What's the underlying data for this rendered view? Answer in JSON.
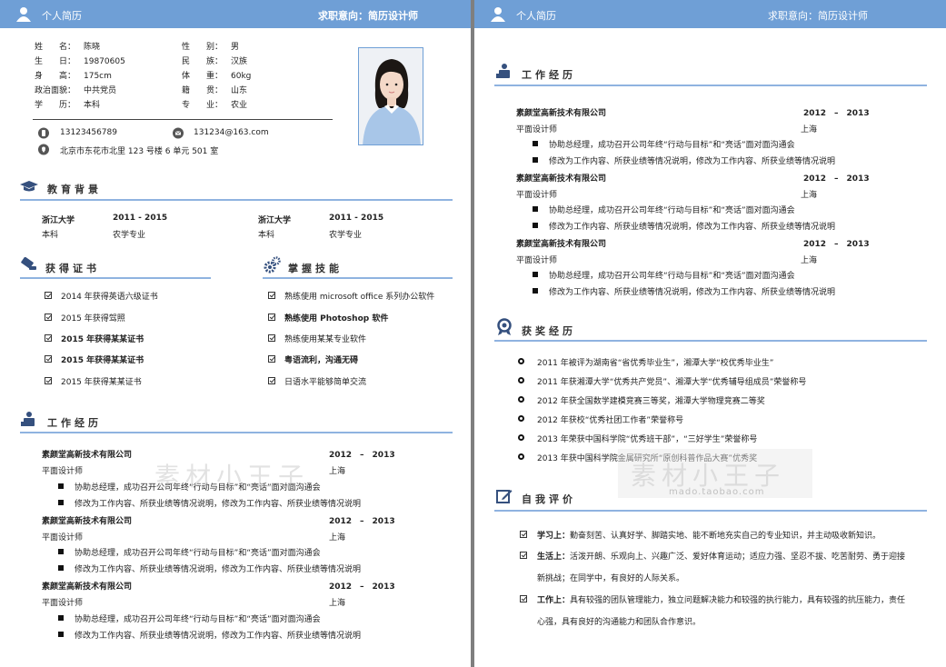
{
  "header": {
    "app_title": "个人简历",
    "objective": "求职意向：简历设计师"
  },
  "personal": {
    "left": [
      {
        "label": "姓　　名：",
        "value": "陈晓"
      },
      {
        "label": "生　　日：",
        "value": "19870605"
      },
      {
        "label": "身　　高：",
        "value": "175cm"
      },
      {
        "label": "政治面貌：",
        "value": "中共党员"
      },
      {
        "label": "学　　历：",
        "value": "本科"
      }
    ],
    "right": [
      {
        "label": "性　　别：",
        "value": "男"
      },
      {
        "label": "民　　族：",
        "value": "汉族"
      },
      {
        "label": "体　　重：",
        "value": "60kg"
      },
      {
        "label": "籍　　贯：",
        "value": "山东"
      },
      {
        "label": "专　　业：",
        "value": "农业"
      }
    ],
    "phone": "13123456789",
    "email": "131234@163.com",
    "address": "北京市东花市北里 123 号楼 6 单元 501 室"
  },
  "education": {
    "title": "教育背景",
    "entries": [
      {
        "school": "浙江大学",
        "years": "2011 - 2015",
        "degree": "本科",
        "major": "农学专业"
      },
      {
        "school": "浙江大学",
        "years": "2011 - 2015",
        "degree": "本科",
        "major": "农学专业"
      }
    ]
  },
  "certificates": {
    "title": "获得证书",
    "items": [
      {
        "text": "2014 年获得英语六级证书",
        "bold": false
      },
      {
        "text": "2015 年获得驾照",
        "bold": false
      },
      {
        "text": "2015 年获得某某证书",
        "bold": true
      },
      {
        "text": "2015 年获得某某证书",
        "bold": true
      },
      {
        "text": "2015 年获得某某证书",
        "bold": false
      }
    ]
  },
  "skills": {
    "title": "掌握技能",
    "items": [
      {
        "text": "熟练使用 microsoft office 系列办公软件",
        "bold": false
      },
      {
        "text": "熟练使用 Photoshop 软件",
        "bold": true
      },
      {
        "text": "熟练使用某某专业软件",
        "bold": false
      },
      {
        "text": "粤语流利，沟通无碍",
        "bold": true
      },
      {
        "text": "日语水平能够简单交流",
        "bold": false
      }
    ]
  },
  "work": {
    "title": "工作经历",
    "entries": [
      {
        "company": "素颜堂高新技术有限公司",
        "period": "2012　–　2013",
        "position": "平面设计师",
        "city": "上海",
        "bullets": [
          "协助总经理，成功召开公司年终“行动与目标”和“亮话”面对面沟通会",
          "修改为工作内容、所获业绩等情况说明，修改为工作内容、所获业绩等情况说明"
        ]
      },
      {
        "company": "素颜堂高新技术有限公司",
        "period": "2012　–　2013",
        "position": "平面设计师",
        "city": "上海",
        "bullets": [
          "协助总经理，成功召开公司年终“行动与目标”和“亮话”面对面沟通会",
          "修改为工作内容、所获业绩等情况说明，修改为工作内容、所获业绩等情况说明"
        ]
      },
      {
        "company": "素颜堂高新技术有限公司",
        "period": "2012　–　2013",
        "position": "平面设计师",
        "city": "上海",
        "bullets": [
          "协助总经理，成功召开公司年终“行动与目标”和“亮话”面对面沟通会",
          "修改为工作内容、所获业绩等情况说明，修改为工作内容、所获业绩等情况说明"
        ]
      }
    ]
  },
  "awards": {
    "title": "获奖经历",
    "items": [
      "2011 年被评为湖南省“省优秀毕业生”，湘潭大学“校优秀毕业生”",
      "2011 年获湘潭大学“优秀共产党员”、湘潭大学“优秀辅导组成员”荣誉称号",
      "2012 年获全国数学建模竞赛三等奖，湘潭大学物理竞赛二等奖",
      "2012 年获校“优秀社团工作者”荣誉称号",
      "2013 年荣获中国科学院“优秀班干部”，“三好学生”荣誉称号",
      "2013 年获中国科学院金属研究所“原创科普作品大赛”优秀奖"
    ]
  },
  "self_eval": {
    "title": "自我评价",
    "items": [
      {
        "label": "学习上：",
        "lines": [
          "勤奋刻苦、认真好学、脚踏实地、能不断地充实自己的专业知识，并主动吸收新知识。"
        ]
      },
      {
        "label": "生活上：",
        "lines": [
          "活泼开朗、乐观向上、兴趣广泛、爱好体育运动；适应力强、坚忍不拔、吃苦耐劳、勇于迎接",
          "新挑战；在同学中，有良好的人际关系。"
        ]
      },
      {
        "label": "工作上：",
        "lines": [
          "具有较强的团队管理能力，独立问题解决能力和较强的执行能力，具有较强的抗压能力，责任",
          "心强，具有良好的沟通能力和团队合作意识。"
        ]
      }
    ]
  },
  "watermark": {
    "text": "素材小王子",
    "sub": "mado.taobao.com"
  },
  "colors": {
    "accent": "#6f9fd6",
    "rule": "#8fb3e0"
  }
}
